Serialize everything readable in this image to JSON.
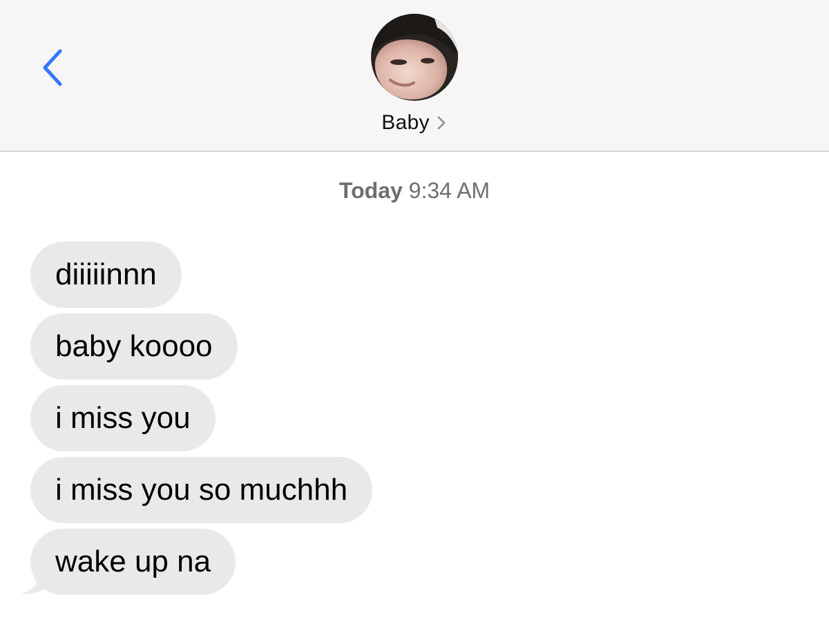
{
  "header": {
    "back_icon": "chevron-left-icon",
    "contact_name": "Baby",
    "contact_chevron_icon": "chevron-right-icon",
    "avatar": "contact-photo"
  },
  "conversation": {
    "timestamp_day": "Today",
    "timestamp_time": "9:34 AM",
    "messages": [
      {
        "text": "diiiiinnn",
        "direction": "incoming"
      },
      {
        "text": "baby koooo",
        "direction": "incoming"
      },
      {
        "text": "i miss you",
        "direction": "incoming"
      },
      {
        "text": "i miss you so muchhh",
        "direction": "incoming"
      },
      {
        "text": "wake up na",
        "direction": "incoming"
      }
    ]
  },
  "colors": {
    "accent": "#3478f6",
    "incoming_bubble": "#e9e9eb",
    "header_background": "#f6f6f7",
    "timestamp_text": "#6e6e73"
  }
}
